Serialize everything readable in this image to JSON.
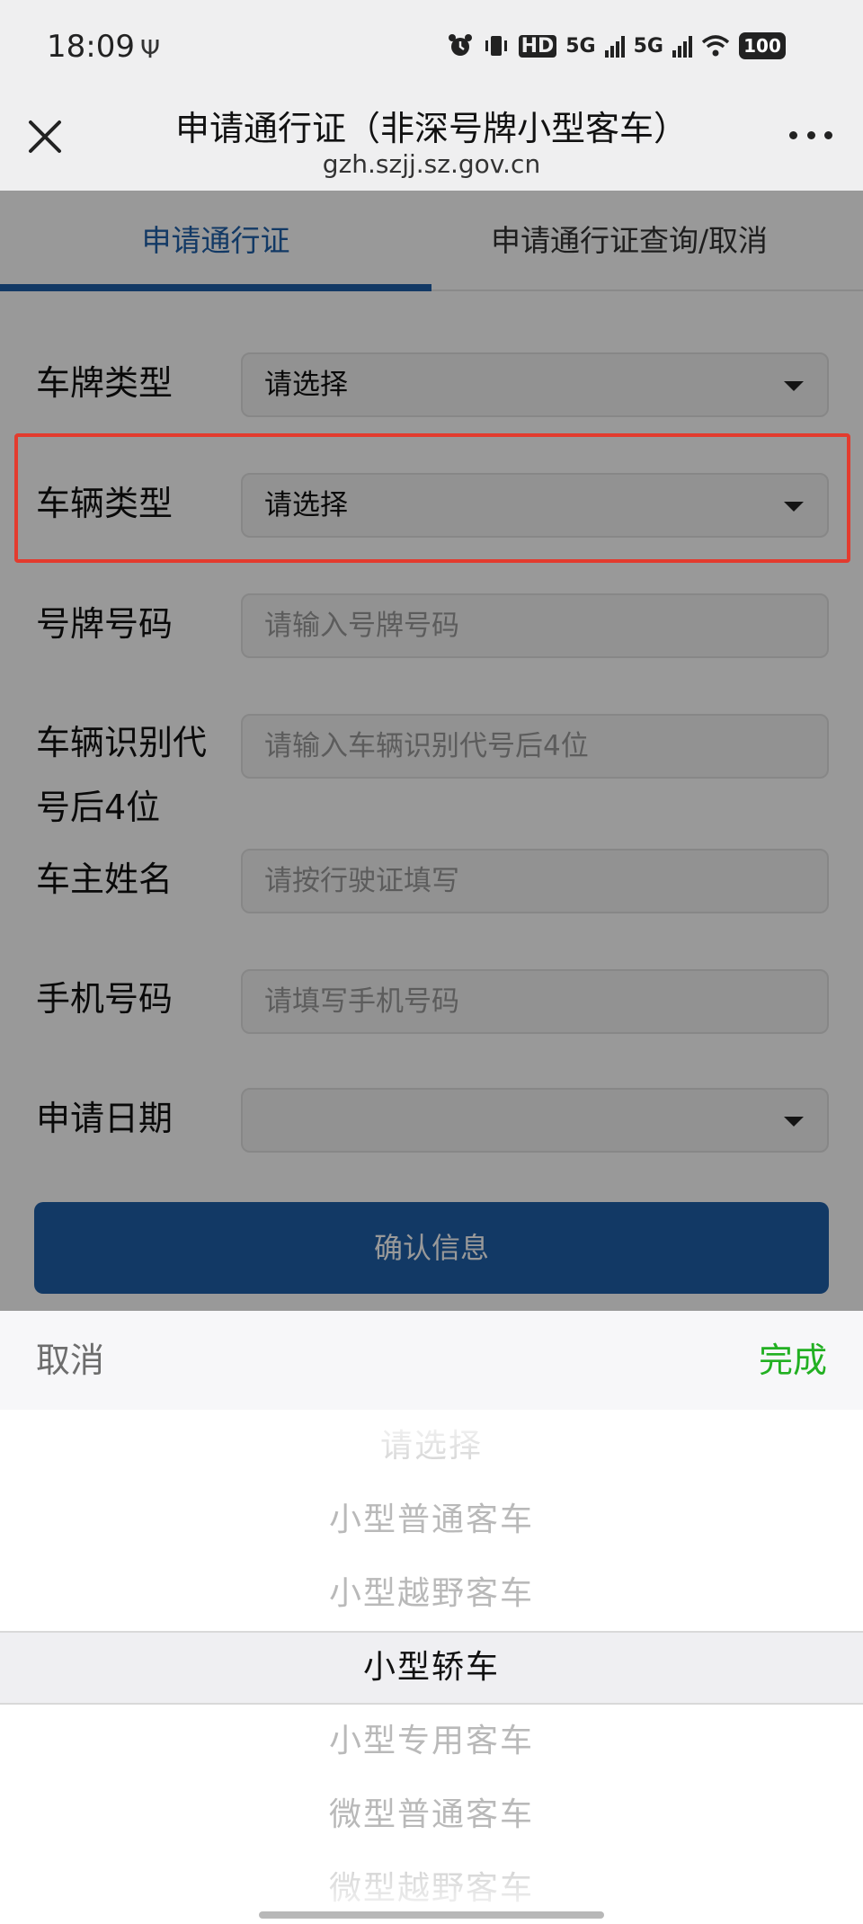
{
  "status_bar": {
    "time": "18:09",
    "icons": [
      "usb-icon",
      "alarm-icon",
      "vibrate-icon",
      "hd-icon",
      "signal-5g-icon",
      "signal-5g-icon",
      "wifi-icon"
    ],
    "hd_label": "HD",
    "net1": "5G",
    "net2": "5G",
    "battery": "100"
  },
  "header": {
    "title": "申请通行证（非深号牌小型客车）",
    "domain": "gzh.szjj.sz.gov.cn"
  },
  "tabs": [
    {
      "label": "申请通行证",
      "active": true
    },
    {
      "label": "申请通行证查询/取消",
      "active": false
    }
  ],
  "accent_color": "#1f5fa8",
  "form": {
    "plate_type": {
      "label": "车牌类型",
      "value": "请选择"
    },
    "vehicle_type": {
      "label": "车辆类型",
      "value": "请选择"
    },
    "plate_number": {
      "label": "号牌号码",
      "placeholder": "请输入号牌号码"
    },
    "vin": {
      "label_line1": "车辆识别代",
      "label_line2": "号后4位",
      "placeholder": "请输入车辆识别代号后4位"
    },
    "owner_name": {
      "label": "车主姓名",
      "placeholder": "请按行驶证填写"
    },
    "phone": {
      "label": "手机号码",
      "placeholder": "请填写手机号码"
    },
    "apply_date": {
      "label": "申请日期",
      "value": ""
    },
    "confirm_label": "确认信息"
  },
  "picker": {
    "cancel": "取消",
    "done": "完成",
    "done_color": "#22b022",
    "options": [
      "请选择",
      "小型普通客车",
      "小型越野客车",
      "小型轿车",
      "小型专用客车",
      "微型普通客车",
      "微型越野客车"
    ],
    "selected_index": 3
  }
}
